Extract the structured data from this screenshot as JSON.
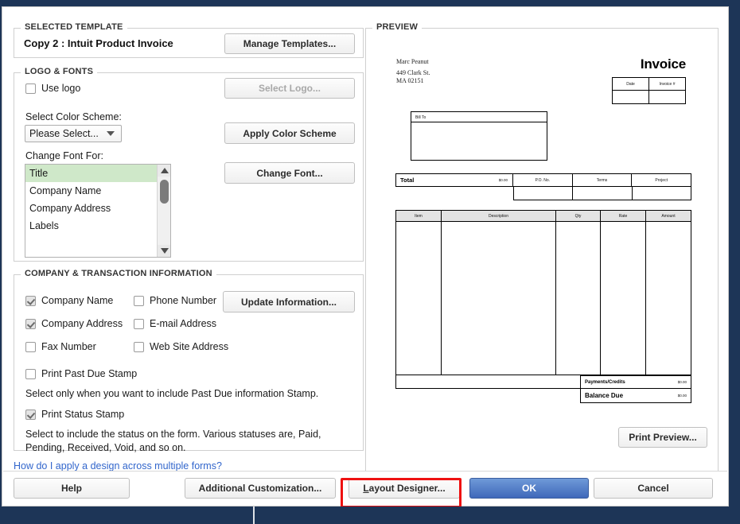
{
  "window": {
    "chrome_color": "#1d3557"
  },
  "selected_template": {
    "group_title": "SELECTED TEMPLATE",
    "name": "Copy 2 : Intuit Product Invoice",
    "manage_templates_label": "Manage Templates..."
  },
  "logo_fonts": {
    "group_title": "LOGO & FONTS",
    "use_logo_label": "Use logo",
    "use_logo_checked": false,
    "select_logo_label": "Select Logo...",
    "select_logo_disabled": true,
    "color_scheme_label": "Select Color Scheme:",
    "color_scheme_value": "Please Select...",
    "apply_color_scheme_label": "Apply Color Scheme",
    "change_font_for_label": "Change Font For:",
    "font_items": [
      {
        "label": "Title",
        "selected": true
      },
      {
        "label": "Company Name",
        "selected": false
      },
      {
        "label": "Company Address",
        "selected": false
      },
      {
        "label": "Labels",
        "selected": false
      }
    ],
    "selected_row_color": "#cfe8c9",
    "change_font_label": "Change Font..."
  },
  "company_info": {
    "group_title": "COMPANY & TRANSACTION INFORMATION",
    "checkboxes": [
      {
        "label": "Company Name",
        "checked": true
      },
      {
        "label": "Phone Number",
        "checked": false
      },
      {
        "label": "Company Address",
        "checked": true
      },
      {
        "label": "E-mail Address",
        "checked": false
      },
      {
        "label": "Fax Number",
        "checked": false
      },
      {
        "label": "Web Site Address",
        "checked": false
      }
    ],
    "update_information_label": "Update Information...",
    "past_due_stamp_label": "Print Past Due Stamp",
    "past_due_stamp_checked": false,
    "past_due_hint": "Select only when you want to include Past Due information Stamp.",
    "status_stamp_label": "Print Status Stamp",
    "status_stamp_checked": true,
    "status_hint": "Select to include the status on the form. Various statuses are, Paid, Pending, Received, Void, and so on."
  },
  "help_link": {
    "label": "How do I apply a design across multiple forms?",
    "color": "#3266cc"
  },
  "preview": {
    "group_title": "PREVIEW",
    "company_name": "Marc Peanut",
    "company_address": "449 Clark St.\nMA 02151",
    "doc_title": "Invoice",
    "date_table_headers": [
      "Date",
      "Invoice #"
    ],
    "bill_to_label": "Bill To",
    "total_label": "Total",
    "total_value": "$0.00",
    "mid_headers": [
      "P.O. No.",
      "Terms",
      "Project"
    ],
    "grid_headers": [
      "Item",
      "Description",
      "Qty",
      "Rate",
      "Amount"
    ],
    "payments_label": "Payments/Credits",
    "payments_value": "$0.00",
    "balance_label": "Balance Due",
    "balance_value": "$0.00",
    "print_preview_label": "Print Preview..."
  },
  "bottom_bar": {
    "help_label": "Help",
    "additional_customization_label": "Additional Customization...",
    "layout_designer_mnemonic": "L",
    "layout_designer_rest": "ayout Designer...",
    "ok_label": "OK",
    "cancel_label": "Cancel",
    "ok_color": "#3f68ba",
    "annotation_color": "#ee1111"
  }
}
